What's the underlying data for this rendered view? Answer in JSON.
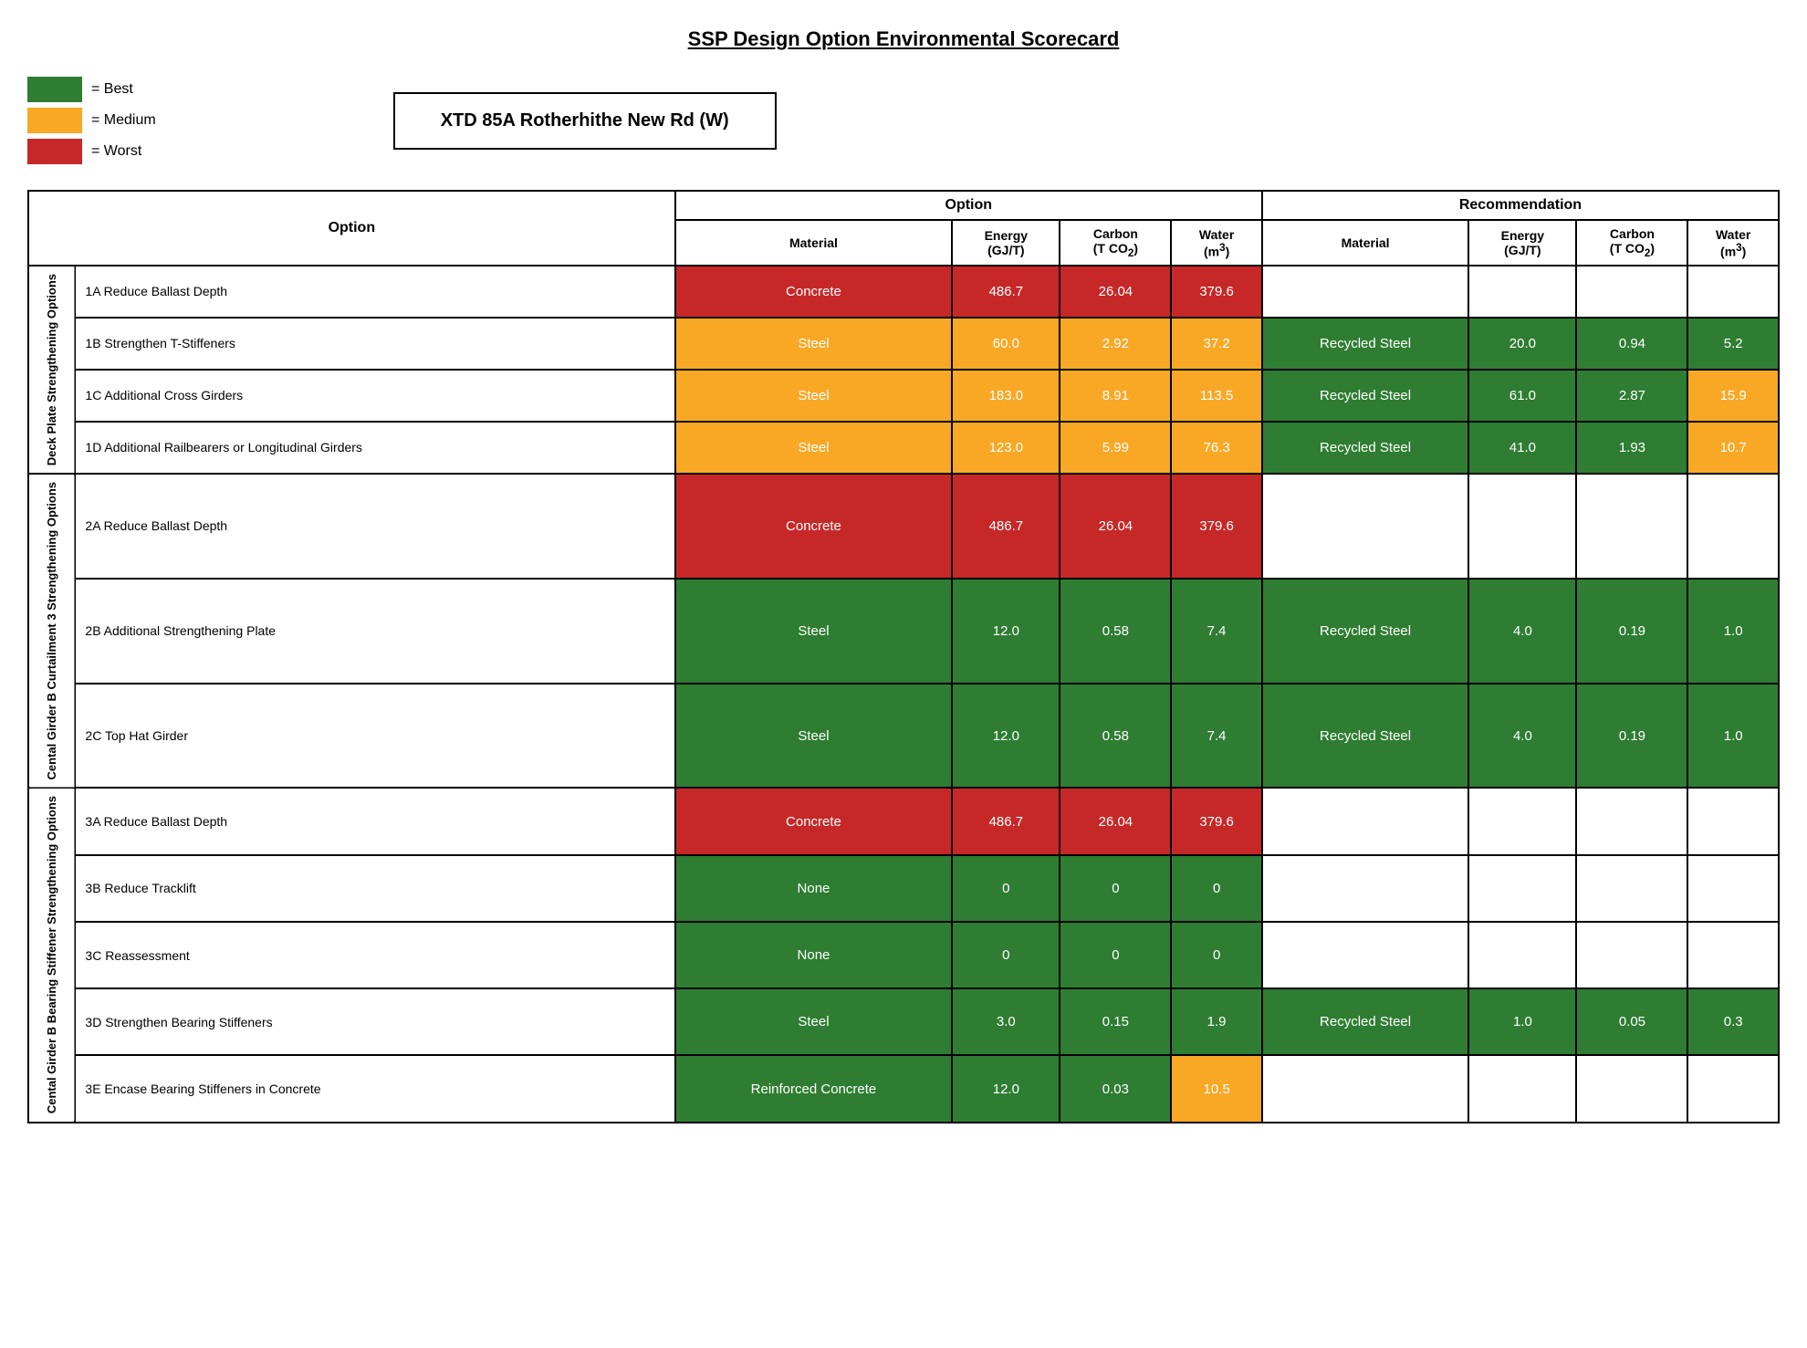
{
  "title": "SSP Design Option Environmental Scorecard",
  "legend": [
    {
      "color": "#2e7d32",
      "label": "= Best"
    },
    {
      "color": "#f9a825",
      "label": "= Medium"
    },
    {
      "color": "#c62828",
      "label": "= Worst"
    }
  ],
  "project": "XTD 85A Rotherhithe New Rd (W)",
  "table": {
    "col_groups": [
      {
        "label": "Option",
        "cols": [
          "Material",
          "Energy\n(GJ/T)",
          "Carbon\n(T CO₂)",
          "Water\n(m³)"
        ]
      },
      {
        "label": "Recommendation",
        "cols": [
          "Material",
          "Energy\n(GJ/T)",
          "Carbon\n(T CO₂)",
          "Water\n(m³)"
        ]
      }
    ],
    "row_groups": [
      {
        "group_label": "Deck Plate Strengthening Options",
        "rows": [
          {
            "option": "1A Reduce Ballast Depth",
            "opt_material": "Concrete",
            "opt_material_color": "red",
            "opt_energy": "486.7",
            "opt_energy_color": "red",
            "opt_carbon": "26.04",
            "opt_carbon_color": "red",
            "opt_water": "379.6",
            "opt_water_color": "red",
            "rec_material": "",
            "rec_material_color": "",
            "rec_energy": "",
            "rec_energy_color": "",
            "rec_carbon": "",
            "rec_carbon_color": "",
            "rec_water": "",
            "rec_water_color": ""
          },
          {
            "option": "1B Strengthen T-Stiffeners",
            "opt_material": "Steel",
            "opt_material_color": "yellow",
            "opt_energy": "60.0",
            "opt_energy_color": "yellow",
            "opt_carbon": "2.92",
            "opt_carbon_color": "yellow",
            "opt_water": "37.2",
            "opt_water_color": "yellow",
            "rec_material": "Recycled Steel",
            "rec_material_color": "green",
            "rec_energy": "20.0",
            "rec_energy_color": "green",
            "rec_carbon": "0.94",
            "rec_carbon_color": "green",
            "rec_water": "5.2",
            "rec_water_color": "green"
          },
          {
            "option": "1C Additional Cross Girders",
            "opt_material": "Steel",
            "opt_material_color": "yellow",
            "opt_energy": "183.0",
            "opt_energy_color": "yellow",
            "opt_carbon": "8.91",
            "opt_carbon_color": "yellow",
            "opt_water": "113.5",
            "opt_water_color": "yellow",
            "rec_material": "Recycled Steel",
            "rec_material_color": "green",
            "rec_energy": "61.0",
            "rec_energy_color": "green",
            "rec_carbon": "2.87",
            "rec_carbon_color": "green",
            "rec_water": "15.9",
            "rec_water_color": "yellow"
          },
          {
            "option": "1D Additional Railbearers or Longitudinal Girders",
            "opt_material": "Steel",
            "opt_material_color": "yellow",
            "opt_energy": "123.0",
            "opt_energy_color": "yellow",
            "opt_carbon": "5.99",
            "opt_carbon_color": "yellow",
            "opt_water": "76.3",
            "opt_water_color": "yellow",
            "rec_material": "Recycled Steel",
            "rec_material_color": "green",
            "rec_energy": "41.0",
            "rec_energy_color": "green",
            "rec_carbon": "1.93",
            "rec_carbon_color": "green",
            "rec_water": "10.7",
            "rec_water_color": "yellow"
          }
        ]
      },
      {
        "group_label": "Cental Girder B Curtailment 3 Strengthening Options",
        "rows": [
          {
            "option": "2A Reduce Ballast Depth",
            "opt_material": "Concrete",
            "opt_material_color": "red",
            "opt_energy": "486.7",
            "opt_energy_color": "red",
            "opt_carbon": "26.04",
            "opt_carbon_color": "red",
            "opt_water": "379.6",
            "opt_water_color": "red",
            "rec_material": "",
            "rec_material_color": "",
            "rec_energy": "",
            "rec_energy_color": "",
            "rec_carbon": "",
            "rec_carbon_color": "",
            "rec_water": "",
            "rec_water_color": ""
          },
          {
            "option": "2B Additional Strengthening Plate",
            "opt_material": "Steel",
            "opt_material_color": "green",
            "opt_energy": "12.0",
            "opt_energy_color": "green",
            "opt_carbon": "0.58",
            "opt_carbon_color": "green",
            "opt_water": "7.4",
            "opt_water_color": "green",
            "rec_material": "Recycled Steel",
            "rec_material_color": "green",
            "rec_energy": "4.0",
            "rec_energy_color": "green",
            "rec_carbon": "0.19",
            "rec_carbon_color": "green",
            "rec_water": "1.0",
            "rec_water_color": "green"
          },
          {
            "option": "2C Top Hat Girder",
            "opt_material": "Steel",
            "opt_material_color": "green",
            "opt_energy": "12.0",
            "opt_energy_color": "green",
            "opt_carbon": "0.58",
            "opt_carbon_color": "green",
            "opt_water": "7.4",
            "opt_water_color": "green",
            "rec_material": "Recycled Steel",
            "rec_material_color": "green",
            "rec_energy": "4.0",
            "rec_energy_color": "green",
            "rec_carbon": "0.19",
            "rec_carbon_color": "green",
            "rec_water": "1.0",
            "rec_water_color": "green"
          }
        ]
      },
      {
        "group_label": "Cental Girder B Bearing Stiffener Strengthening Options",
        "rows": [
          {
            "option": "3A Reduce Ballast Depth",
            "opt_material": "Concrete",
            "opt_material_color": "red",
            "opt_energy": "486.7",
            "opt_energy_color": "red",
            "opt_carbon": "26.04",
            "opt_carbon_color": "red",
            "opt_water": "379.6",
            "opt_water_color": "red",
            "rec_material": "",
            "rec_material_color": "",
            "rec_energy": "",
            "rec_energy_color": "",
            "rec_carbon": "",
            "rec_carbon_color": "",
            "rec_water": "",
            "rec_water_color": ""
          },
          {
            "option": "3B Reduce Tracklift",
            "opt_material": "None",
            "opt_material_color": "green",
            "opt_energy": "0",
            "opt_energy_color": "green",
            "opt_carbon": "0",
            "opt_carbon_color": "green",
            "opt_water": "0",
            "opt_water_color": "green",
            "rec_material": "",
            "rec_material_color": "",
            "rec_energy": "",
            "rec_energy_color": "",
            "rec_carbon": "",
            "rec_carbon_color": "",
            "rec_water": "",
            "rec_water_color": ""
          },
          {
            "option": "3C Reassessment",
            "opt_material": "None",
            "opt_material_color": "green",
            "opt_energy": "0",
            "opt_energy_color": "green",
            "opt_carbon": "0",
            "opt_carbon_color": "green",
            "opt_water": "0",
            "opt_water_color": "green",
            "rec_material": "",
            "rec_material_color": "",
            "rec_energy": "",
            "rec_energy_color": "",
            "rec_carbon": "",
            "rec_carbon_color": "",
            "rec_water": "",
            "rec_water_color": ""
          },
          {
            "option": "3D Strengthen Bearing Stiffeners",
            "opt_material": "Steel",
            "opt_material_color": "green",
            "opt_energy": "3.0",
            "opt_energy_color": "green",
            "opt_carbon": "0.15",
            "opt_carbon_color": "green",
            "opt_water": "1.9",
            "opt_water_color": "green",
            "rec_material": "Recycled Steel",
            "rec_material_color": "green",
            "rec_energy": "1.0",
            "rec_energy_color": "green",
            "rec_carbon": "0.05",
            "rec_carbon_color": "green",
            "rec_water": "0.3",
            "rec_water_color": "green"
          },
          {
            "option": "3E Encase Bearing Stiffeners in Concrete",
            "opt_material": "Reinforced Concrete",
            "opt_material_color": "green",
            "opt_energy": "12.0",
            "opt_energy_color": "green",
            "opt_carbon": "0.03",
            "opt_carbon_color": "green",
            "opt_water": "10.5",
            "opt_water_color": "yellow",
            "rec_material": "",
            "rec_material_color": "",
            "rec_energy": "",
            "rec_energy_color": "",
            "rec_carbon": "",
            "rec_carbon_color": "",
            "rec_water": "",
            "rec_water_color": ""
          }
        ]
      }
    ]
  }
}
